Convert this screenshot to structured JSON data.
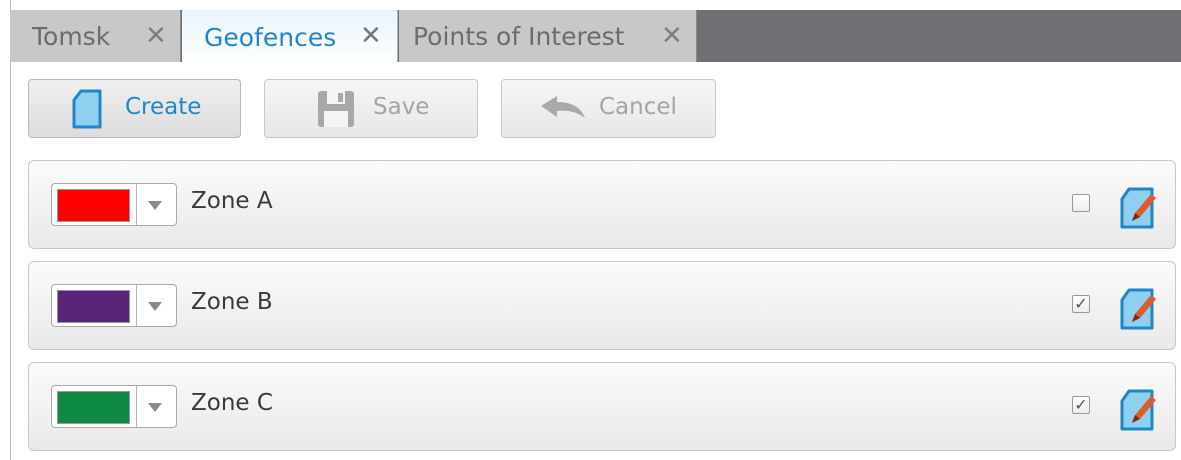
{
  "tabs": [
    {
      "label": "Tomsk",
      "active": false
    },
    {
      "label": "Geofences",
      "active": true
    },
    {
      "label": "Points of Interest",
      "active": false
    }
  ],
  "close_glyph": "✕",
  "toolbar": {
    "create_label": "Create",
    "create_icon": "create-icon",
    "save_label": "Save",
    "save_icon": "floppy-disk-icon",
    "cancel_label": "Cancel",
    "cancel_icon": "undo-arrow-icon"
  },
  "zones": [
    {
      "name": "Zone A",
      "color": "#ff0000",
      "visible": false
    },
    {
      "name": "Zone B",
      "color": "#572479",
      "visible": true
    },
    {
      "name": "Zone C",
      "color": "#0f8a44",
      "visible": true
    }
  ],
  "colors": {
    "accent": "#1f87c8",
    "tabbar": "#6f7073",
    "edit_pencil": "#e05a2a"
  }
}
